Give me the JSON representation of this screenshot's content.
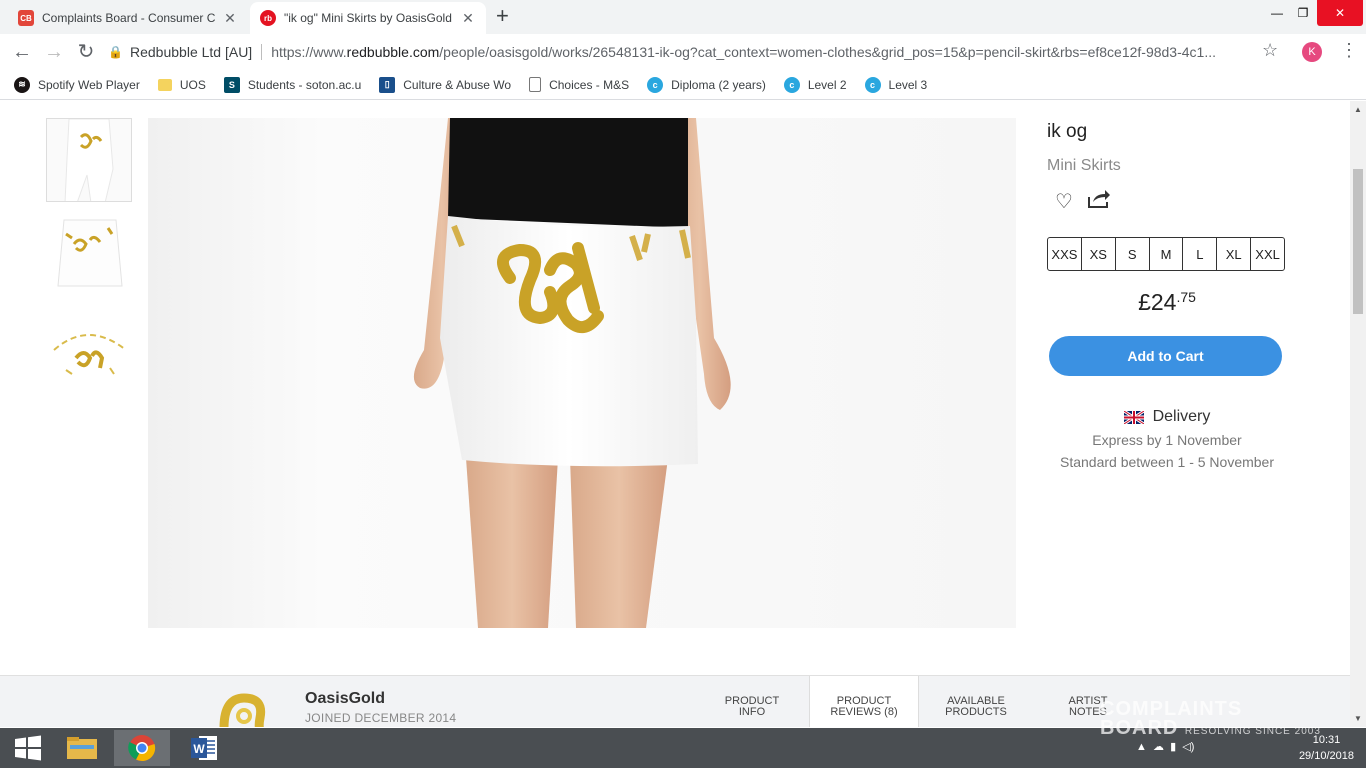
{
  "browser": {
    "tabs": [
      {
        "title": "Complaints Board - Consumer C",
        "favicon": "CB",
        "color": "#e2463a",
        "active": false
      },
      {
        "title": "\"ik og\" Mini Skirts by OasisGold",
        "favicon": "rb",
        "color": "#e41321",
        "active": true
      }
    ],
    "newtab": "+",
    "window_controls": {
      "minimize": "—",
      "restore": "❐",
      "close": "✕"
    },
    "nav": {
      "back": "←",
      "forward": "→",
      "reload": "↻"
    },
    "omnibox": {
      "org": "Redbubble Ltd [AU]",
      "url_prefix": "https://www.",
      "url_domain": "redbubble.com",
      "url_rest": "/people/oasisgold/works/26548131-ik-og?cat_context=women-clothes&grid_pos=15&p=pencil-skirt&rbs=ef8ce12f-98d3-4c1..."
    },
    "star": "☆",
    "profile_initial": "K",
    "menu": "⋮",
    "bookmarks": [
      {
        "label": "Spotify Web Player",
        "icon": "spotify-icon",
        "color": "#1db954"
      },
      {
        "label": "UOS",
        "icon": "folder-icon",
        "color": "#f4d35e"
      },
      {
        "label": "Students - soton.ac.u",
        "icon": "s-icon",
        "color": "#004d66"
      },
      {
        "label": "Culture & Abuse Wo",
        "icon": "doc-icon",
        "color": "#1a4f8b"
      },
      {
        "label": "Choices - M&S",
        "icon": "page-icon",
        "color": "#ffffff"
      },
      {
        "label": "Diploma (2 years)",
        "icon": "city-icon",
        "color": "#2aa7df"
      },
      {
        "label": "Level 2",
        "icon": "city-icon",
        "color": "#2aa7df"
      },
      {
        "label": "Level 3",
        "icon": "city-icon",
        "color": "#2aa7df"
      }
    ]
  },
  "product": {
    "title": "ik og",
    "type": "Mini Skirts",
    "sizes": [
      "XXS",
      "XS",
      "S",
      "M",
      "L",
      "XL",
      "XXL"
    ],
    "price_main": "£24",
    "price_cents": ".75",
    "add_to_cart": "Add to Cart",
    "delivery": {
      "heading": "Delivery",
      "express": "Express by 1 November",
      "standard": "Standard between 1 - 5 November"
    }
  },
  "artist": {
    "name": "OasisGold",
    "joined": "JOINED DECEMBER 2014"
  },
  "footer_tabs": [
    {
      "line1": "PRODUCT",
      "line2": "INFO",
      "active": false
    },
    {
      "line1": "PRODUCT",
      "line2": "REVIEWS (8)",
      "active": true
    },
    {
      "line1": "AVAILABLE",
      "line2": "PRODUCTS",
      "active": false
    },
    {
      "line1": "ARTIST",
      "line2": "NOTES",
      "active": false
    }
  ],
  "taskbar": {
    "time": "10:31",
    "date": "29/10/2018"
  },
  "watermark": {
    "line1": "COMPLAINTS",
    "line2": "BOARD",
    "tagline": "RESOLVING SINCE 2003"
  }
}
